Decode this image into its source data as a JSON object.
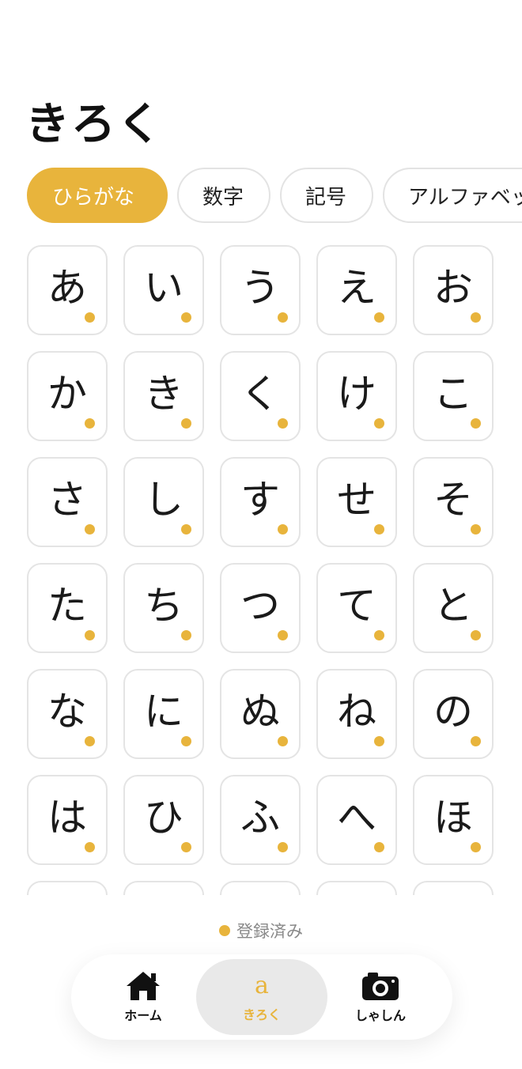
{
  "header": {
    "title": "きろく"
  },
  "tabs": [
    {
      "label": "ひらがな",
      "active": true
    },
    {
      "label": "数字",
      "active": false
    },
    {
      "label": "記号",
      "active": false
    },
    {
      "label": "アルファベット",
      "active": false
    }
  ],
  "characters": [
    [
      "あ",
      "い",
      "う",
      "え",
      "お"
    ],
    [
      "か",
      "き",
      "く",
      "け",
      "こ"
    ],
    [
      "さ",
      "し",
      "す",
      "せ",
      "そ"
    ],
    [
      "た",
      "ち",
      "つ",
      "て",
      "と"
    ],
    [
      "な",
      "に",
      "ぬ",
      "ね",
      "の"
    ],
    [
      "は",
      "ひ",
      "ふ",
      "へ",
      "ほ"
    ],
    [
      "",
      "",
      "",
      "",
      ""
    ]
  ],
  "legend": {
    "label": "登録済み"
  },
  "nav": [
    {
      "label": "ホーム",
      "icon": "home-icon",
      "active": false
    },
    {
      "label": "きろく",
      "icon": "a",
      "active": true
    },
    {
      "label": "しゃしん",
      "icon": "camera-icon",
      "active": false
    }
  ],
  "colors": {
    "accent": "#E8B43C",
    "border": "#e4e4e4"
  }
}
